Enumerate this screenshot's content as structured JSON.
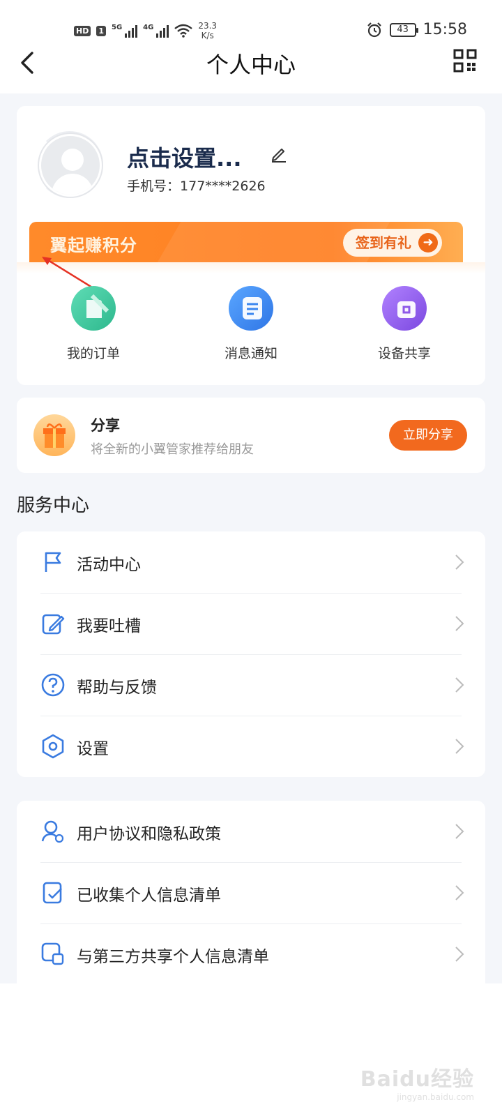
{
  "status_bar": {
    "hd": "HD",
    "sim": "1",
    "net1": "5G",
    "net2": "4G",
    "speed_value": "23.3",
    "speed_unit": "K/s",
    "battery": "43",
    "time": "15:58"
  },
  "nav": {
    "title": "个人中心",
    "back_icon": "chevron-left-icon",
    "qr_icon": "qr-code-icon"
  },
  "profile": {
    "name": "点击设置...",
    "phone_label": "手机号：",
    "phone": "177****2626"
  },
  "promo": {
    "title": "翼起赚积分",
    "checkin_label": "签到有礼",
    "arrow": "➜"
  },
  "quick_actions": [
    {
      "label": "我的订单",
      "icon": "order-icon",
      "color": "#3cc39a"
    },
    {
      "label": "消息通知",
      "icon": "message-icon",
      "color": "#3a86ef"
    },
    {
      "label": "设备共享",
      "icon": "device-share-icon",
      "color": "#8e5ae8"
    }
  ],
  "share": {
    "title": "分享",
    "subtitle": "将全新的小翼管家推荐给朋友",
    "button": "立即分享"
  },
  "service_center": {
    "title": "服务中心",
    "items": [
      {
        "label": "活动中心",
        "icon": "flag-icon"
      },
      {
        "label": "我要吐槽",
        "icon": "feedback-edit-icon"
      },
      {
        "label": "帮助与反馈",
        "icon": "help-icon"
      },
      {
        "label": "设置",
        "icon": "settings-icon"
      }
    ]
  },
  "legal": {
    "items": [
      {
        "label": "用户协议和隐私政策",
        "icon": "user-agreement-icon"
      },
      {
        "label": "已收集个人信息清单",
        "icon": "collected-info-icon"
      },
      {
        "label": "与第三方共享个人信息清单",
        "icon": "third-party-share-icon"
      }
    ]
  },
  "colors": {
    "accent_orange": "#f2691e",
    "icon_blue": "#3a7be0",
    "background": "#f4f6fa"
  },
  "watermark": {
    "main": "Baidu经验",
    "sub": "jingyan.baidu.com"
  }
}
